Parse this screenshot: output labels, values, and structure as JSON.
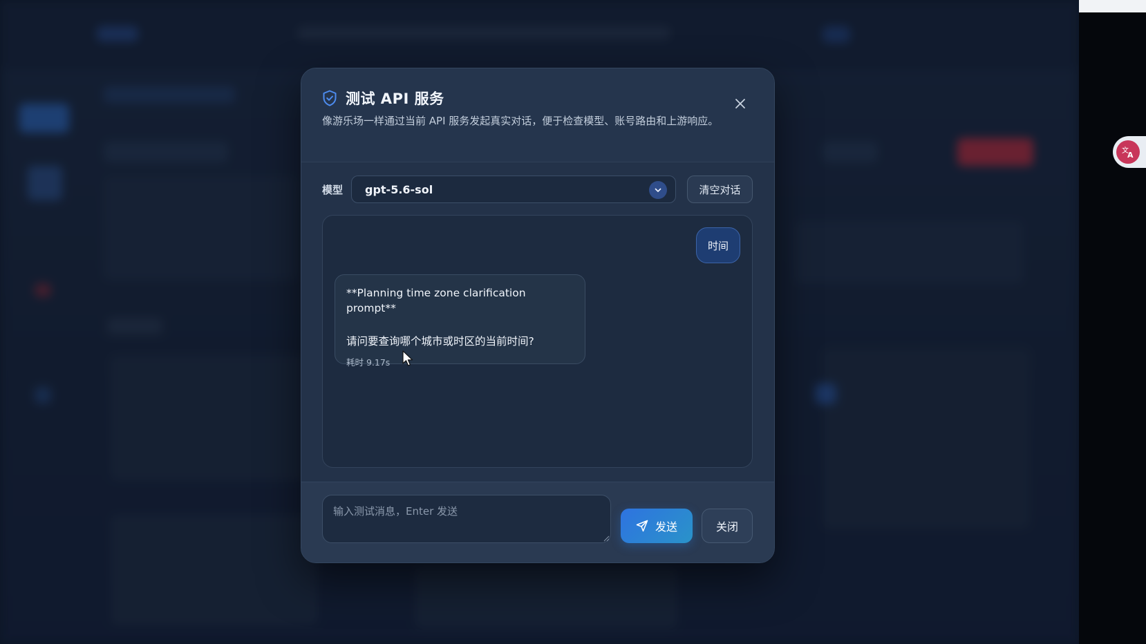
{
  "modal": {
    "title": "测试 API 服务",
    "description": "像游乐场一样通过当前 API 服务发起真实对话，便于检查模型、账号路由和上游响应。",
    "close_icon": "close-icon",
    "title_icon": "shield-check-icon"
  },
  "model": {
    "label": "模型",
    "selected": "gpt-5.6-sol",
    "chevron_icon": "chevron-down-icon"
  },
  "clear_button": {
    "label": "清空对话"
  },
  "chat": {
    "user_message": "时间",
    "assistant_message": {
      "line1": "**Planning time zone clarification prompt**",
      "line2": "请问要查询哪个城市或时区的当前时间?",
      "meta": "耗时 9.17s"
    }
  },
  "composer": {
    "placeholder": "输入测试消息，Enter 发送",
    "value": "",
    "send_label": "发送",
    "send_icon": "send-icon",
    "close_label": "关闭"
  },
  "theme": {
    "accent": "#2e73e0",
    "modal_bg": "#233249",
    "page_bg": "#1b2a42"
  }
}
